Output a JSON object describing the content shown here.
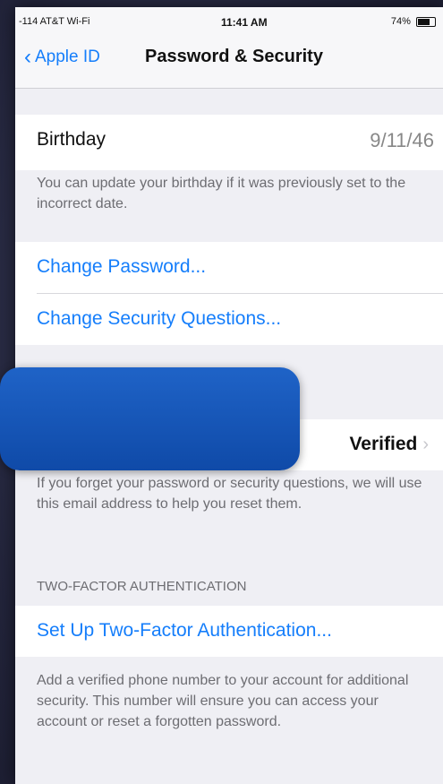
{
  "status_bar": {
    "carrier": "-114 AT&T Wi-Fi",
    "time": "11:41 AM",
    "battery": "74%"
  },
  "nav": {
    "back_label": "Apple ID",
    "title": "Password & Security"
  },
  "birthday": {
    "label": "Birthday",
    "value": "9/11/46",
    "note": "You can update your birthday if it was previously set to the incorrect date."
  },
  "actions": {
    "change_password": "Change Password...",
    "change_security_questions": "Change Security Questions..."
  },
  "rescue_email": {
    "status": "Verified",
    "note": "If you forget your password or security questions, we will use this email address to help you reset them."
  },
  "two_factor": {
    "header": "TWO-FACTOR AUTHENTICATION",
    "setup_label": "Set Up Two-Factor Authentication...",
    "note": "Add a verified phone number to your account for additional security. This number will ensure you can access your account or reset a forgotten password."
  },
  "colors": {
    "accent": "#157efb",
    "overlay": "#1a5bbf",
    "background": "#efeff4"
  }
}
